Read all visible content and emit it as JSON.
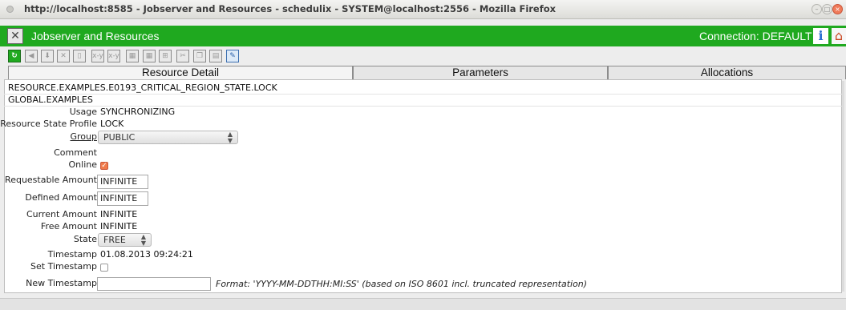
{
  "window": {
    "title": "http://localhost:8585 - Jobserver and Resources - schedulix - SYSTEM@localhost:2556 - Mozilla Firefox"
  },
  "app": {
    "title": "Jobserver and Resources",
    "connection": "Connection: DEFAULT",
    "info_glyph": "i",
    "home_icon": "home-icon"
  },
  "toolbar": {
    "icons": [
      "refresh-icon",
      "back-icon",
      "download-icon",
      "close-icon",
      "new-document-icon",
      "x-y-icon",
      "x-y-icon",
      "grid-icon",
      "grid-icon",
      "table-icon",
      "cut-icon",
      "copy-icon",
      "paste-icon",
      "edit-icon"
    ],
    "xy_label": "x-y"
  },
  "tabs": [
    {
      "label": "Resource Detail",
      "active": true
    },
    {
      "label": "Parameters",
      "active": false
    },
    {
      "label": "Allocations",
      "active": false
    }
  ],
  "resource": {
    "path": "RESOURCE.EXAMPLES.E0193_CRITICAL_REGION_STATE.LOCK",
    "scope": "GLOBAL.EXAMPLES"
  },
  "fields": {
    "usage": {
      "label": "Usage",
      "value": "SYNCHRONIZING"
    },
    "state_profile": {
      "label": "Resource State Profile",
      "value": "LOCK"
    },
    "group": {
      "label": "Group",
      "value": "PUBLIC"
    },
    "comment": {
      "label": "Comment",
      "value": ""
    },
    "online": {
      "label": "Online",
      "checked": true
    },
    "requestable_amount": {
      "label": "Requestable Amount",
      "value": "INFINITE"
    },
    "defined_amount": {
      "label": "Defined Amount",
      "value": "INFINITE"
    },
    "current_amount": {
      "label": "Current Amount",
      "value": "INFINITE"
    },
    "free_amount": {
      "label": "Free Amount",
      "value": "INFINITE"
    },
    "state": {
      "label": "State",
      "value": "FREE"
    },
    "timestamp": {
      "label": "Timestamp",
      "value": "01.08.2013 09:24:21"
    },
    "set_timestamp": {
      "label": "Set Timestamp",
      "checked": false
    },
    "new_timestamp": {
      "label": "New Timestamp",
      "value": "",
      "hint": "Format: 'YYYY-MM-DDTHH:MI:SS' (based on ISO 8601 incl. truncated representation)"
    }
  },
  "colors": {
    "accent_green": "#1fa91f",
    "checkbox_on": "#f07a4a"
  }
}
